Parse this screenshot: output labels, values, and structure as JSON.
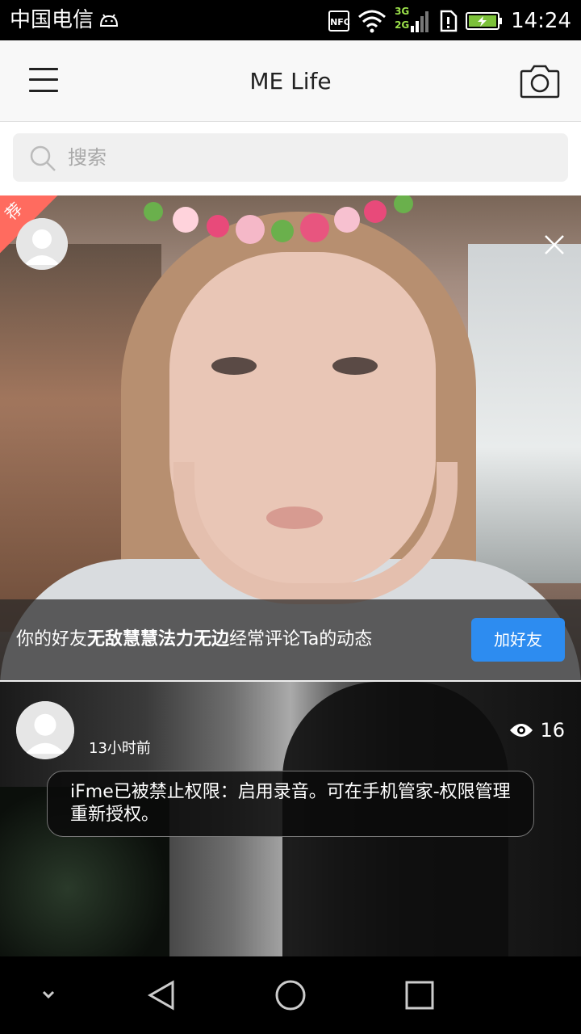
{
  "status_bar": {
    "carrier": "中国电信",
    "nfc": "NFC",
    "network_top": "3G",
    "network_bottom": "2G",
    "time": "14:24",
    "icons": [
      "android-icon",
      "nfc-icon",
      "wifi-icon",
      "signal-icon",
      "sim-alert-icon",
      "battery-charging-icon"
    ]
  },
  "app_bar": {
    "title": "ME Life",
    "left_icon": "menu-icon",
    "right_icon": "camera-icon"
  },
  "search": {
    "placeholder": "搜索",
    "icon": "search-icon"
  },
  "feed": {
    "card1": {
      "badge": "荐",
      "badge_color": "#ff6b5f",
      "suggestion_prefix": "你的好友",
      "friend_name": "无敌慧慧法力无边",
      "suggestion_suffix": "经常评论Ta的动态",
      "add_button": "加好友",
      "add_button_color": "#2d8cf0",
      "close_icon": "close-icon"
    },
    "card2": {
      "time_ago": "13小时前",
      "views": "16",
      "views_icon": "eye-icon"
    }
  },
  "toast": {
    "message": "iFme已被禁止权限：启用录音。可在手机管家-权限管理重新授权。"
  },
  "nav_bar": {
    "buttons": [
      "collapse-icon",
      "back-icon",
      "home-icon",
      "recents-icon"
    ]
  }
}
